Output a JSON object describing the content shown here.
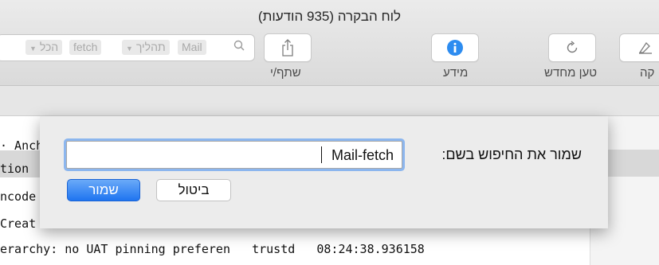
{
  "window": {
    "title": "לוח הבקרה (935 הודעות)"
  },
  "search": {
    "tokens": [
      {
        "label": "הכל"
      },
      {
        "label": "fetch"
      },
      {
        "label": "תהליך"
      },
      {
        "label": "Mail"
      }
    ]
  },
  "toolbar": {
    "share_label": "שתף/י",
    "info_label": "מידע",
    "reload_label": "טען מחדש",
    "partial_label": "קה"
  },
  "log": {
    "rows": [
      "· Anch",
      "tion",
      "ncode",
      "Creat",
      "erarchy: no UAT pinning preferen   trustd   08:24:38.936158"
    ]
  },
  "dialog": {
    "label": "שמור את החיפוש בשם:",
    "input_value": "Mail-fetch",
    "save_label": "שמור",
    "cancel_label": "ביטול"
  },
  "colors": {
    "accent": "#1f74f0",
    "focus_ring": "#8cb6ee",
    "info_icon": "#2d8cf0"
  }
}
